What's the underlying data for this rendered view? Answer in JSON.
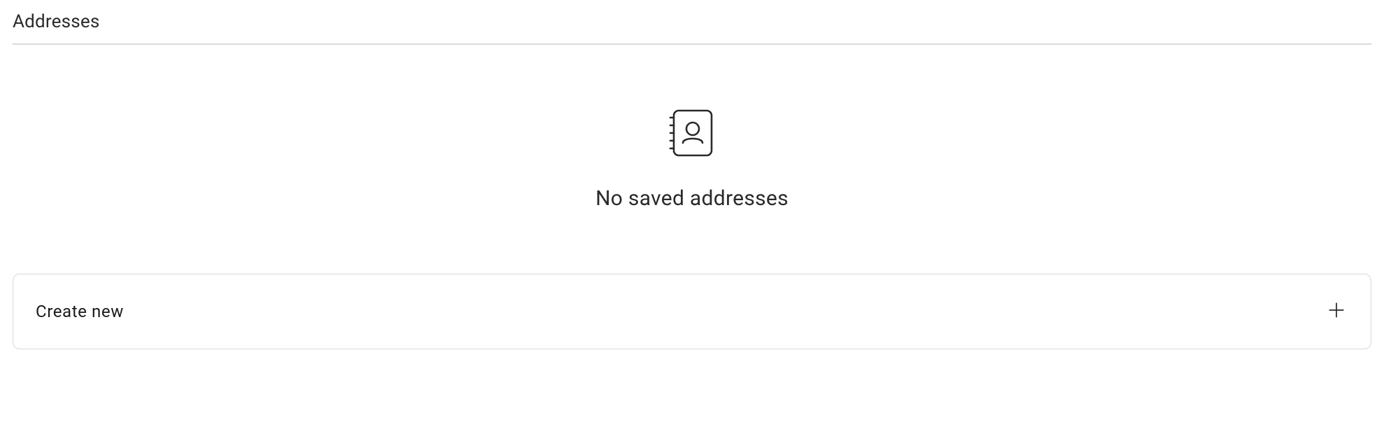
{
  "section": {
    "title": "Addresses"
  },
  "empty_state": {
    "message": "No saved addresses",
    "icon": "address-book"
  },
  "actions": {
    "create_new_label": "Create new"
  }
}
